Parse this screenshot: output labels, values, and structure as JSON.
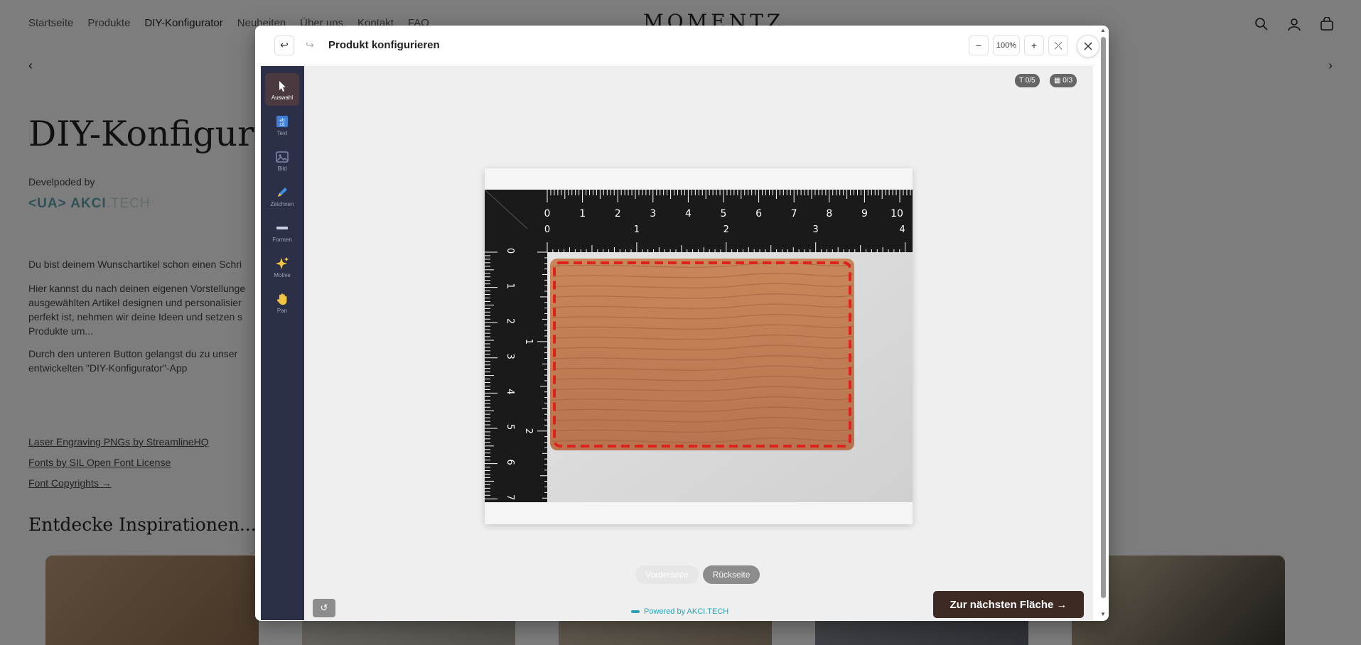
{
  "store": {
    "nav": [
      "Startseite",
      "Produkte",
      "DIY-Konfigurator",
      "Neuheiten",
      "Über uns",
      "Kontakt",
      "FAQ"
    ],
    "nav_active": "DIY-Konfigurator",
    "logo": "MOMENTZ",
    "hero_title": "DIY-Konfigurat",
    "dev_by": "Develpoded by",
    "akci_brand": "<UA> AKCI",
    "akci_tech": ".TECH",
    "para1": "Du bist deinem Wunschartikel schon einen Schri",
    "para2": "Hier kannst du nach deinen eigenen Vorstellunge ausgewählten Artikel designen und personalisier perfekt ist, nehmen wir deine Ideen und setzen s Produkte um...",
    "para3": "Durch den unteren Button gelangst du zu unser entwickelten \"DIY-Konfigurator\"-App",
    "links": [
      "Laser Engraving PNGs by StreamlineHQ",
      "Fonts by SIL Open Font License",
      "Font Copyrights →"
    ],
    "inspiration_title": "Entdecke Inspirationen..."
  },
  "modal": {
    "title": "Produkt konfigurieren",
    "undo_icon": "↩",
    "redo_icon": "↪",
    "zoom_out": "−",
    "zoom_value": "100%",
    "zoom_in": "+",
    "fit_icon": "⤫",
    "text_badge": "T 0/5",
    "image_badge": "▦ 0/3",
    "tools": [
      {
        "label": "Auswahl",
        "icon": "cursor-icon",
        "active": true
      },
      {
        "label": "Text",
        "icon": "text-icon",
        "active": false
      },
      {
        "label": "Bild",
        "icon": "image-icon",
        "active": false
      },
      {
        "label": "Zeichnen",
        "icon": "pen-icon",
        "active": false
      },
      {
        "label": "Formen",
        "icon": "shape-icon",
        "active": false
      },
      {
        "label": "Motive",
        "icon": "sparkle-icon",
        "active": false
      },
      {
        "label": "Pan",
        "icon": "hand-icon",
        "active": false
      }
    ],
    "sides": {
      "front": "Vorderseite",
      "back": "Rückseite",
      "selected": "Rückseite"
    },
    "reset_icon": "↺",
    "powered_by": "Powered by AKCI.TECH",
    "next_button": "Zur nächsten Fläche →"
  },
  "ruler": {
    "top_cm": [
      "0",
      "1",
      "2",
      "3",
      "4",
      "5",
      "6",
      "7",
      "8",
      "9",
      "10"
    ],
    "top_inch": [
      "0",
      "1",
      "2",
      "3",
      "4"
    ],
    "left_cm": [
      "0",
      "1",
      "2",
      "3",
      "4",
      "5",
      "6",
      "7"
    ],
    "left_inch": [
      "1",
      "2"
    ]
  },
  "colors": {
    "accent_dark": "#3d2a22",
    "toolbar": "#2c2f48",
    "dashed_border": "#e0201b",
    "brand_teal": "#2aa3b4"
  }
}
